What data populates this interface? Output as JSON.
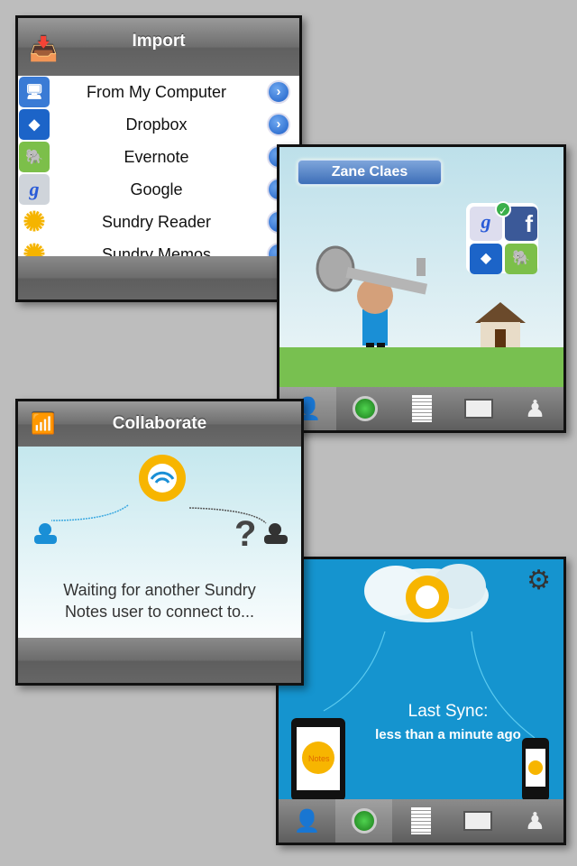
{
  "import": {
    "title": "Import",
    "icon": "import-tray-icon",
    "items": [
      {
        "label": "From My Computer",
        "icon": "computer-icon",
        "color": "#3a7bd5"
      },
      {
        "label": "Dropbox",
        "icon": "dropbox-icon",
        "color": "#1c64c8"
      },
      {
        "label": "Evernote",
        "icon": "evernote-icon",
        "color": "#7cbf4a"
      },
      {
        "label": "Google",
        "icon": "google-icon",
        "color": "#cfd4da"
      },
      {
        "label": "Sundry Reader",
        "icon": "sundry-reader-icon",
        "color": "#f5c400"
      },
      {
        "label": "Sundry Memos",
        "icon": "sundry-memos-icon",
        "color": "#f5c400"
      }
    ]
  },
  "profile": {
    "user_name": "Zane Claes"
  },
  "collaborate": {
    "title": "Collaborate",
    "message_line1": "Waiting for another Sundry",
    "message_line2": "Notes user to connect to..."
  },
  "sync": {
    "label": "Last Sync:",
    "value": "less than a minute ago",
    "device_label": "Notes"
  },
  "tabs": [
    "profile-tab",
    "sync-tab",
    "notes-tab",
    "display-tab",
    "pawn-tab"
  ],
  "colors": {
    "accent_blue": "#1594cf",
    "grass": "#78c050",
    "badge": "#4a7cc2"
  }
}
